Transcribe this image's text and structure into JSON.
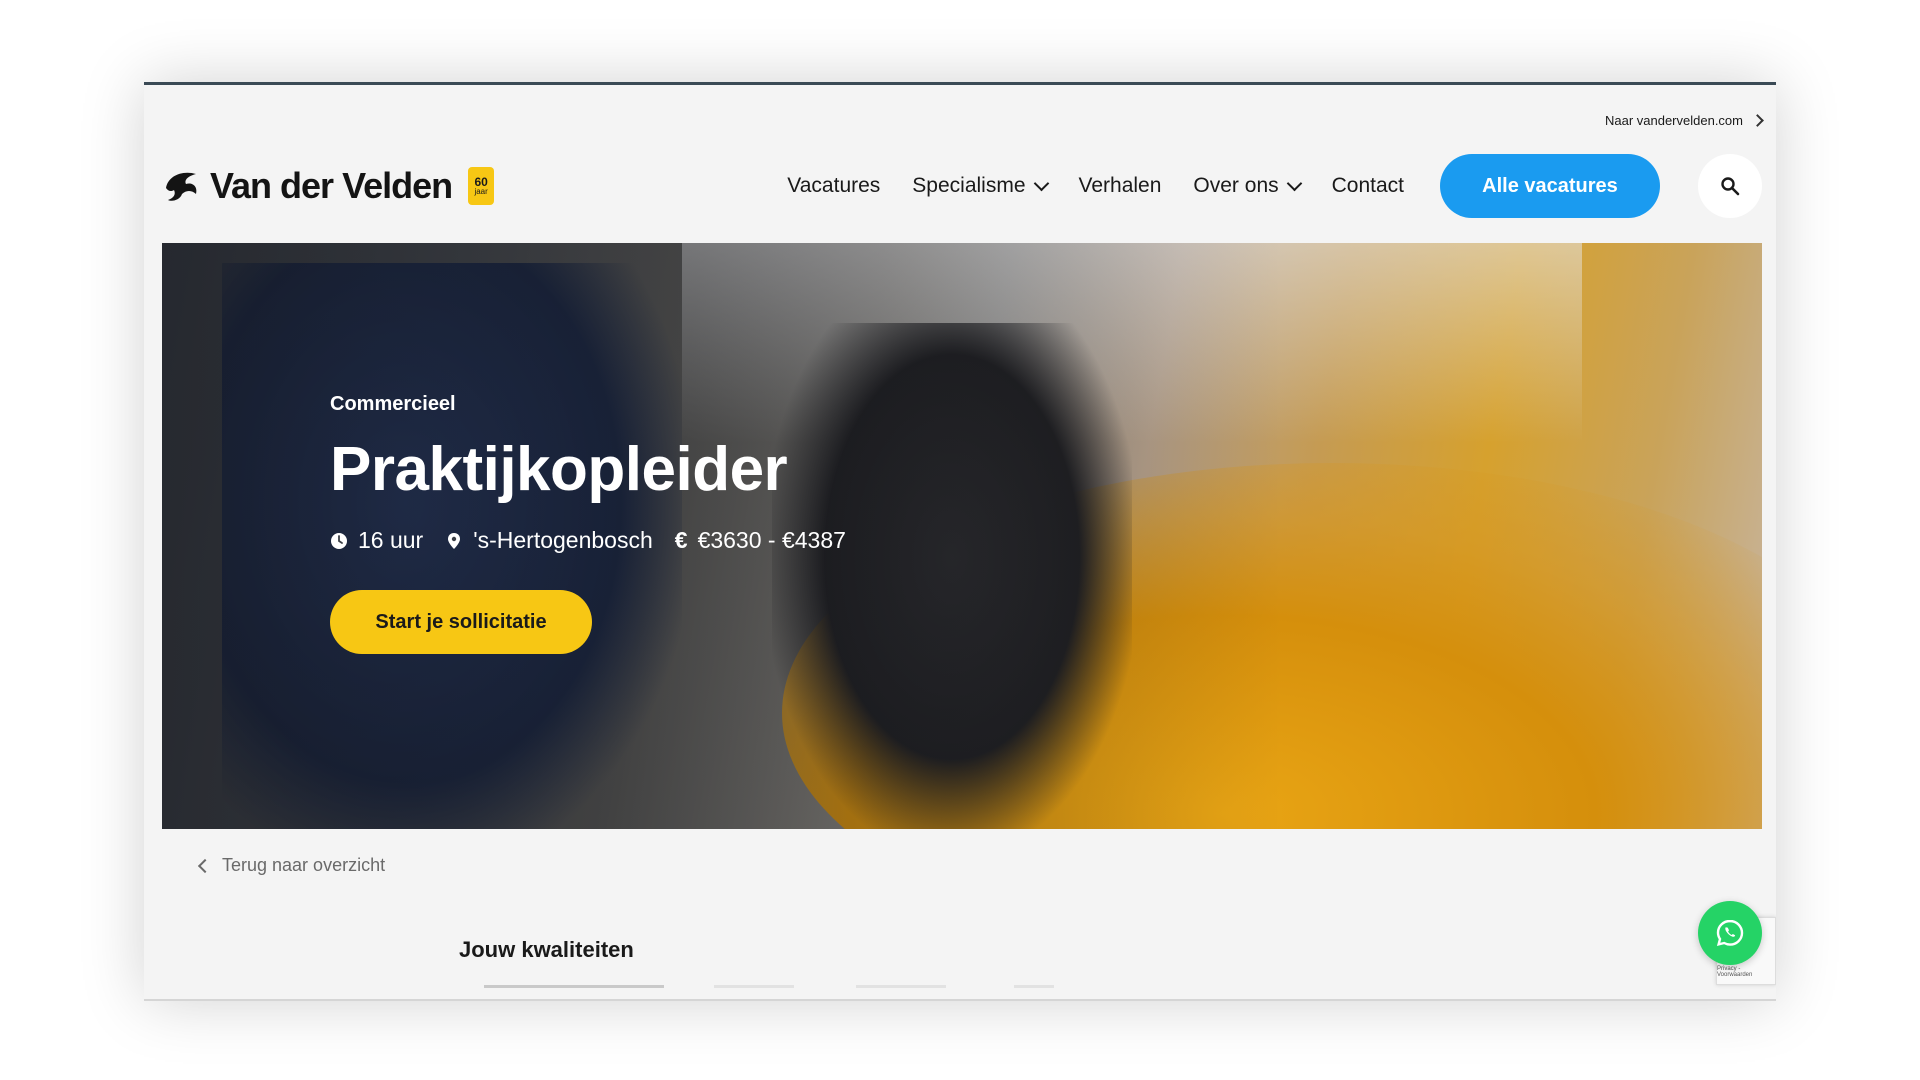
{
  "top_link": {
    "label": "Naar vandervelden.com"
  },
  "brand": {
    "name": "Van der Velden",
    "badge_number": "60",
    "badge_word": "jaar",
    "accent": "#f7c714"
  },
  "nav": {
    "items": [
      {
        "label": "Vacatures"
      },
      {
        "label": "Specialisme"
      },
      {
        "label": "Verhalen"
      },
      {
        "label": "Over ons"
      },
      {
        "label": "Contact"
      }
    ],
    "cta_label": "Alle vacatures",
    "cta_color": "#1a9bf0"
  },
  "hero": {
    "category": "Commercieel",
    "title": "Praktijkopleider",
    "hours": "16 uur",
    "location": "'s-Hertogenbosch",
    "salary": "€3630 - €4387",
    "apply_label": "Start je sollicitatie"
  },
  "back_link": {
    "label": "Terug naar overzicht"
  },
  "section": {
    "title": "Jouw kwaliteiten"
  },
  "recaptcha": {
    "text": "Privacy - Voorwaarden"
  },
  "icons": [
    "logo-icon",
    "search-icon",
    "clock-icon",
    "pin-icon",
    "euro-icon",
    "chevron-left-icon",
    "whatsapp-icon"
  ]
}
